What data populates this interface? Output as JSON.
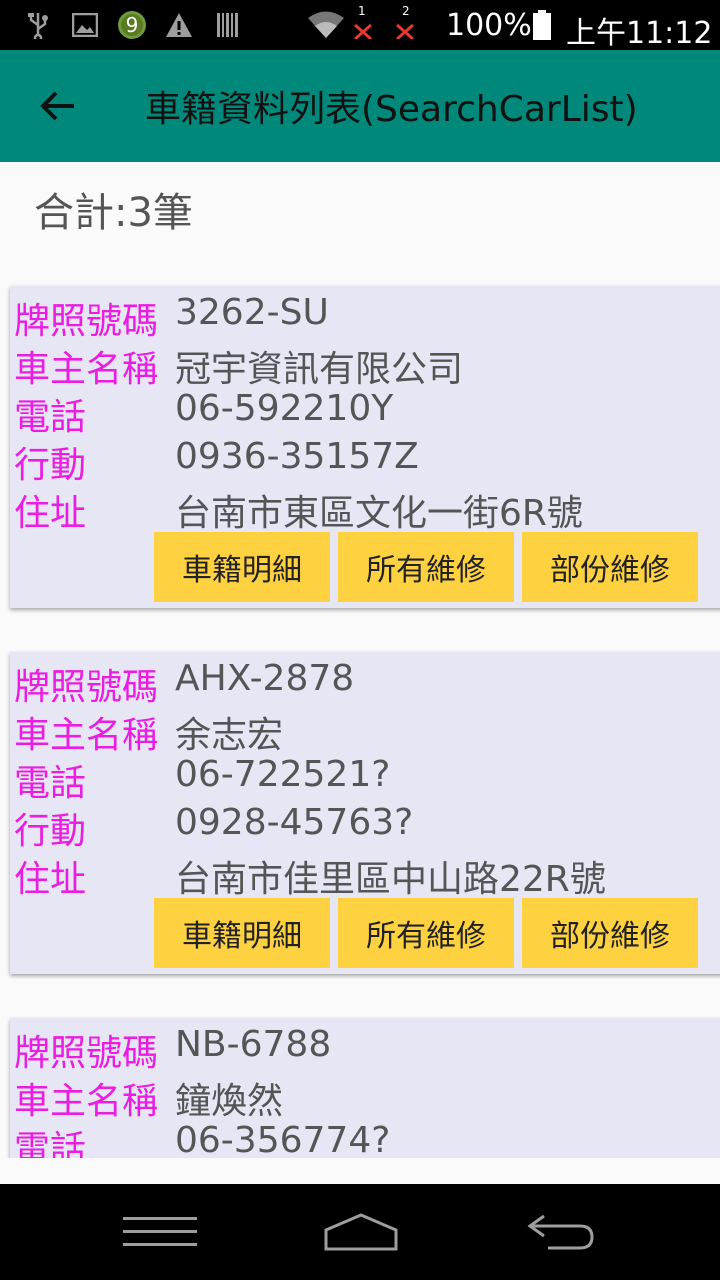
{
  "status_bar": {
    "sim1": "1",
    "sim2": "2",
    "battery": "100%",
    "time": "上午11:12",
    "icons": [
      "usb-icon",
      "image-icon",
      "badge-icon",
      "warning-icon",
      "barcode-icon",
      "wifi-icon",
      "signal-icon",
      "battery-icon"
    ],
    "badge_number": "9"
  },
  "app_bar": {
    "title": "車籍資料列表(SearchCarList)",
    "back_icon": "back-arrow-icon",
    "color": "#00897b"
  },
  "summary": {
    "total": "合計:3筆"
  },
  "labels": {
    "plate": "牌照號碼",
    "owner": "車主名稱",
    "phone": "電話",
    "mobile": "行動",
    "address": "住址"
  },
  "buttons": {
    "detail": "車籍明細",
    "all_repairs": "所有維修",
    "partial_repairs": "部份維修"
  },
  "cars": [
    {
      "plate": "3262-SU",
      "owner": "冠宇資訊有限公司",
      "phone": "06-592210Y",
      "mobile": "0936-35157Z",
      "address": "台南市東區文化一街6R號"
    },
    {
      "plate": "AHX-2878",
      "owner": "余志宏",
      "phone": "06-722521?",
      "mobile": "0928-45763?",
      "address": "台南市佳里區中山路22R號"
    },
    {
      "plate": "NB-6788",
      "owner": "鐘煥然",
      "phone": "06-356774?"
    }
  ],
  "nav_bar": {
    "icons": [
      "menu-icon",
      "home-icon",
      "back-icon"
    ]
  }
}
